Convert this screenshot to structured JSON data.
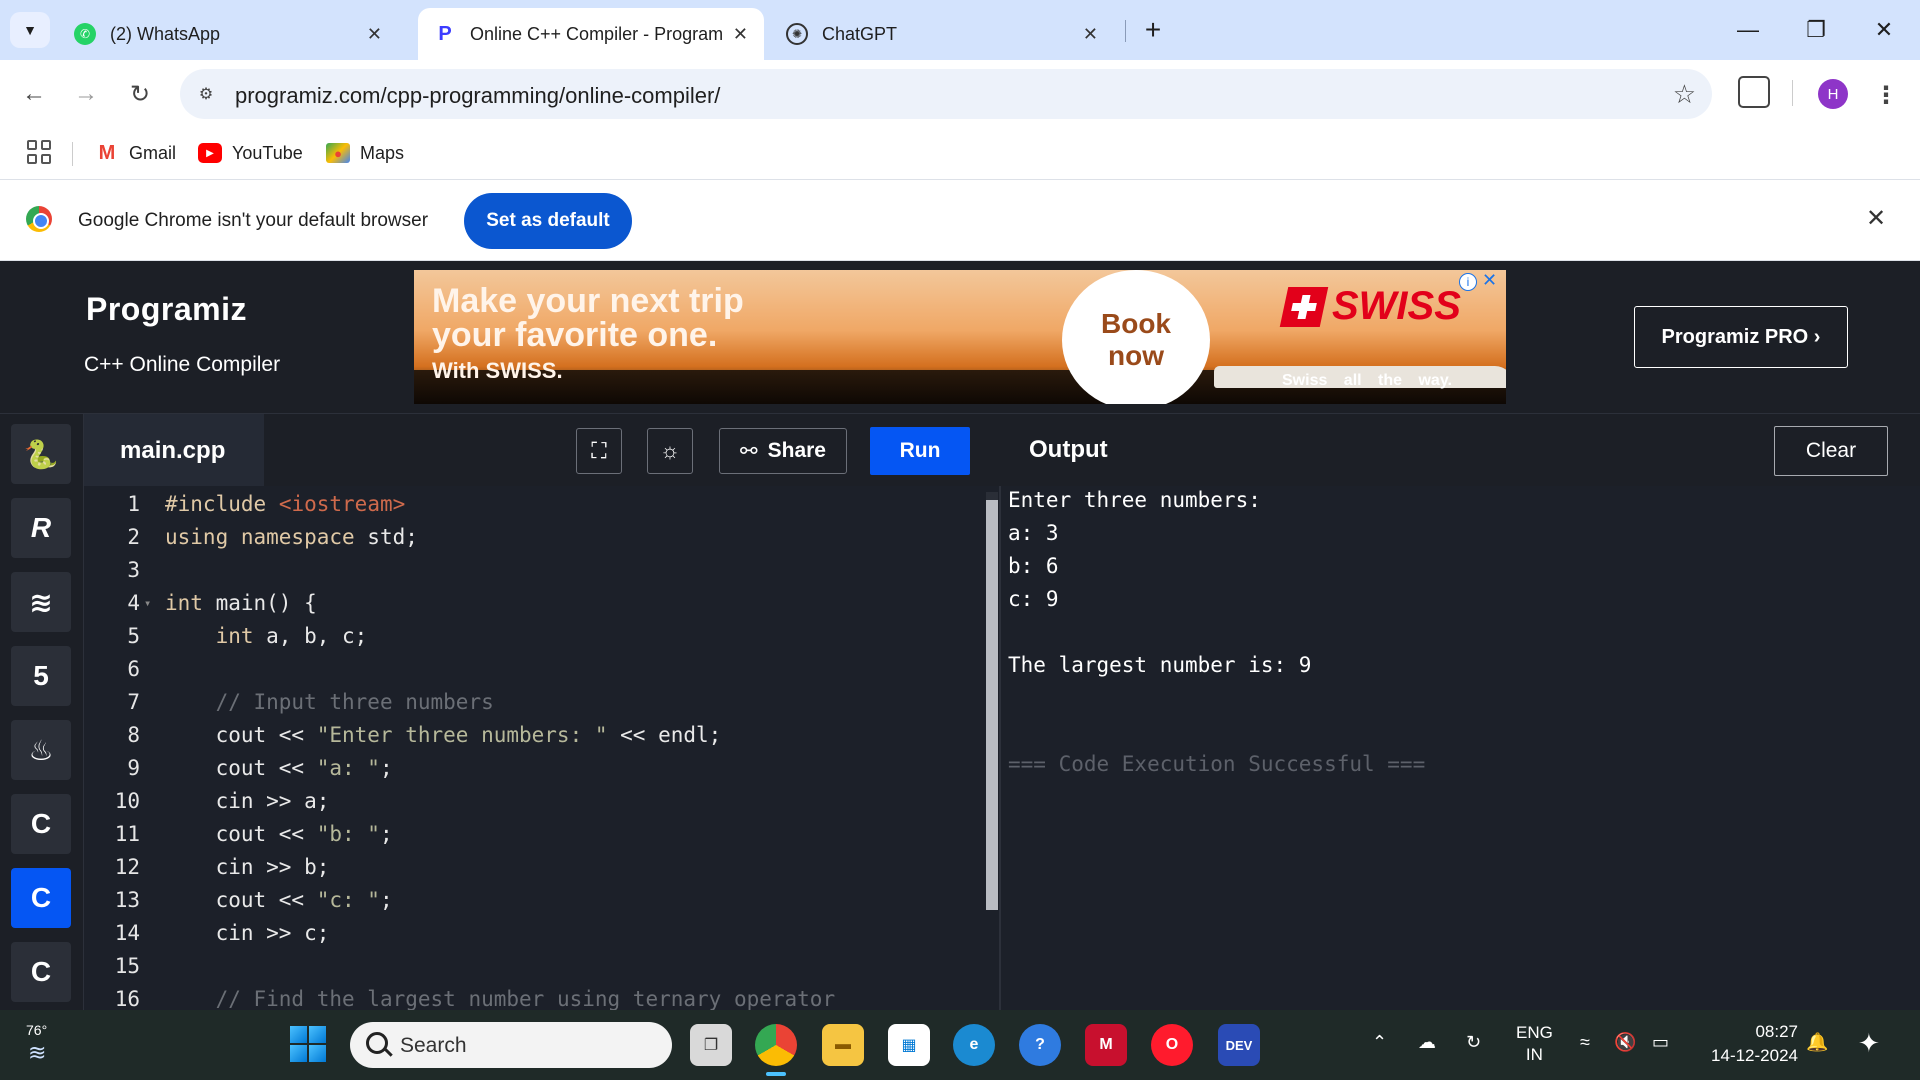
{
  "browser": {
    "tabs": [
      {
        "title": "(2) WhatsApp",
        "icon": "whatsapp-icon",
        "active": false
      },
      {
        "title": "Online C++ Compiler - Programiz",
        "icon": "programiz-icon",
        "active": true
      },
      {
        "title": "ChatGPT",
        "icon": "chatgpt-icon",
        "active": false
      }
    ],
    "url": "programiz.com/cpp-programming/online-compiler/",
    "profile_initial": "H",
    "bookmarks": [
      {
        "label": "Gmail",
        "icon": "gmail-icon"
      },
      {
        "label": "YouTube",
        "icon": "youtube-icon"
      },
      {
        "label": "Maps",
        "icon": "maps-icon"
      }
    ],
    "infobar": {
      "message": "Google Chrome isn't your default browser",
      "button": "Set as default"
    }
  },
  "header": {
    "logo": "Programiz",
    "subtitle": "C++ Online Compiler",
    "pro_button": "Programiz PRO ›",
    "ad": {
      "line1": "Make your next trip",
      "line2": "your favorite one.",
      "line3": "With SWISS.",
      "cta_line1": "Book",
      "cta_line2": "now",
      "brand": "SWISS",
      "slogan": "Swiss all the way."
    }
  },
  "languages": [
    {
      "name": "python-icon",
      "glyph": "🐍",
      "active": false
    },
    {
      "name": "r-icon",
      "glyph": "R",
      "active": false
    },
    {
      "name": "sql-icon",
      "glyph": "≋",
      "active": false
    },
    {
      "name": "html5-icon",
      "glyph": "5",
      "active": false
    },
    {
      "name": "java-icon",
      "glyph": "♨",
      "active": false
    },
    {
      "name": "c-icon",
      "glyph": "C",
      "active": false
    },
    {
      "name": "cpp-icon",
      "glyph": "C",
      "active": true
    },
    {
      "name": "csharp-icon",
      "glyph": "C",
      "active": false
    }
  ],
  "editor": {
    "file_name": "main.cpp",
    "share_label": "Share",
    "run_label": "Run",
    "lines": [
      {
        "n": "1",
        "html": "<span class=\"kw\">#include</span> <span class=\"inc\">&lt;iostream&gt;</span>"
      },
      {
        "n": "2",
        "html": "<span class=\"kw\">using namespace</span> std;"
      },
      {
        "n": "3",
        "html": ""
      },
      {
        "n": "4",
        "html": "<span class=\"kw\">int</span> main() {",
        "fold": true
      },
      {
        "n": "5",
        "html": "    <span class=\"kw\">int</span> a, b, c;"
      },
      {
        "n": "6",
        "html": ""
      },
      {
        "n": "7",
        "html": "    <span class=\"cm\">// Input three numbers</span>"
      },
      {
        "n": "8",
        "html": "    cout &lt;&lt; <span class=\"str\">\"Enter three numbers: \"</span> &lt;&lt; endl;"
      },
      {
        "n": "9",
        "html": "    cout &lt;&lt; <span class=\"str\">\"a: \"</span>;"
      },
      {
        "n": "10",
        "html": "    cin &gt;&gt; a;"
      },
      {
        "n": "11",
        "html": "    cout &lt;&lt; <span class=\"str\">\"b: \"</span>;"
      },
      {
        "n": "12",
        "html": "    cin &gt;&gt; b;"
      },
      {
        "n": "13",
        "html": "    cout &lt;&lt; <span class=\"str\">\"c: \"</span>;"
      },
      {
        "n": "14",
        "html": "    cin &gt;&gt; c;"
      },
      {
        "n": "15",
        "html": ""
      },
      {
        "n": "16",
        "html": "    <span class=\"cm\">// Find the largest number using ternary operator</span>"
      }
    ]
  },
  "output": {
    "title": "Output",
    "clear_label": "Clear",
    "lines": [
      {
        "text": "Enter three numbers:",
        "dim": false
      },
      {
        "text": "a: 3",
        "dim": false
      },
      {
        "text": "b: 6",
        "dim": false
      },
      {
        "text": "c: 9",
        "dim": false
      },
      {
        "text": "",
        "dim": false
      },
      {
        "text": "The largest number is: 9",
        "dim": false
      },
      {
        "text": "",
        "dim": false
      },
      {
        "text": "",
        "dim": false
      },
      {
        "text": "=== Code Execution Successful ===",
        "dim": true
      }
    ]
  },
  "taskbar": {
    "temperature": "76°",
    "search_placeholder": "Search",
    "language_line1": "ENG",
    "language_line2": "IN",
    "time": "08:27",
    "date": "14-12-2024"
  },
  "colors": {
    "accent": "#0556f3",
    "editor_bg": "#1c2029",
    "chrome_frame": "#d3e3fd"
  }
}
